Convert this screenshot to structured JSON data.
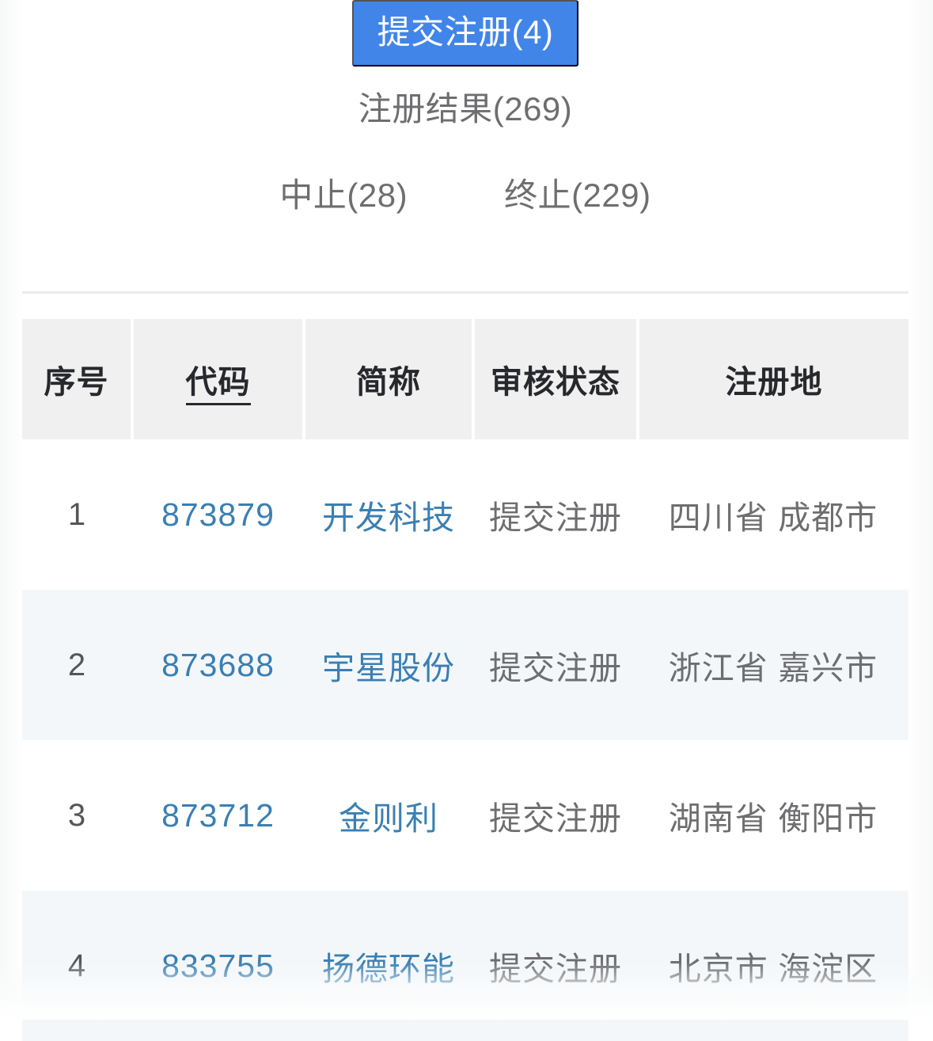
{
  "filters": {
    "active_tab": {
      "label": "提交注册(4)",
      "name": "提交注册",
      "count": 4,
      "accent_color": "#4285e8"
    },
    "tabs": [
      {
        "label": "注册结果(269)",
        "name": "注册结果",
        "count": 269,
        "selected": false
      },
      {
        "label": "中止(28)",
        "name": "中止",
        "count": 28,
        "selected": false
      },
      {
        "label": "终止(229)",
        "name": "终止",
        "count": 229,
        "selected": false
      }
    ]
  },
  "table": {
    "columns": [
      {
        "key": "seq",
        "label": "序号",
        "underlined": false
      },
      {
        "key": "code",
        "label": "代码",
        "underlined": true
      },
      {
        "key": "short",
        "label": "简称",
        "underlined": false
      },
      {
        "key": "status",
        "label": "审核状态",
        "underlined": false
      },
      {
        "key": "region",
        "label": "注册地",
        "underlined": false
      }
    ],
    "rows": [
      {
        "seq": "1",
        "code": "873879",
        "short": "开发科技",
        "status": "提交注册",
        "region": "四川省 成都市"
      },
      {
        "seq": "2",
        "code": "873688",
        "short": "宇星股份",
        "status": "提交注册",
        "region": "浙江省 嘉兴市"
      },
      {
        "seq": "3",
        "code": "873712",
        "short": "金则利",
        "status": "提交注册",
        "region": "湖南省 衡阳市"
      },
      {
        "seq": "4",
        "code": "833755",
        "short": "扬德环能",
        "status": "提交注册",
        "region": "北京市 海淀区"
      }
    ]
  },
  "watermark": {
    "text": ""
  },
  "colors": {
    "accent_blue": "#4285e8",
    "link_blue": "#3b7fb2",
    "header_bg": "#f0f0f1",
    "row_alt_bg": "#f3f7fa",
    "text_gray": "#6e6e70",
    "text_dark": "#27282b"
  }
}
